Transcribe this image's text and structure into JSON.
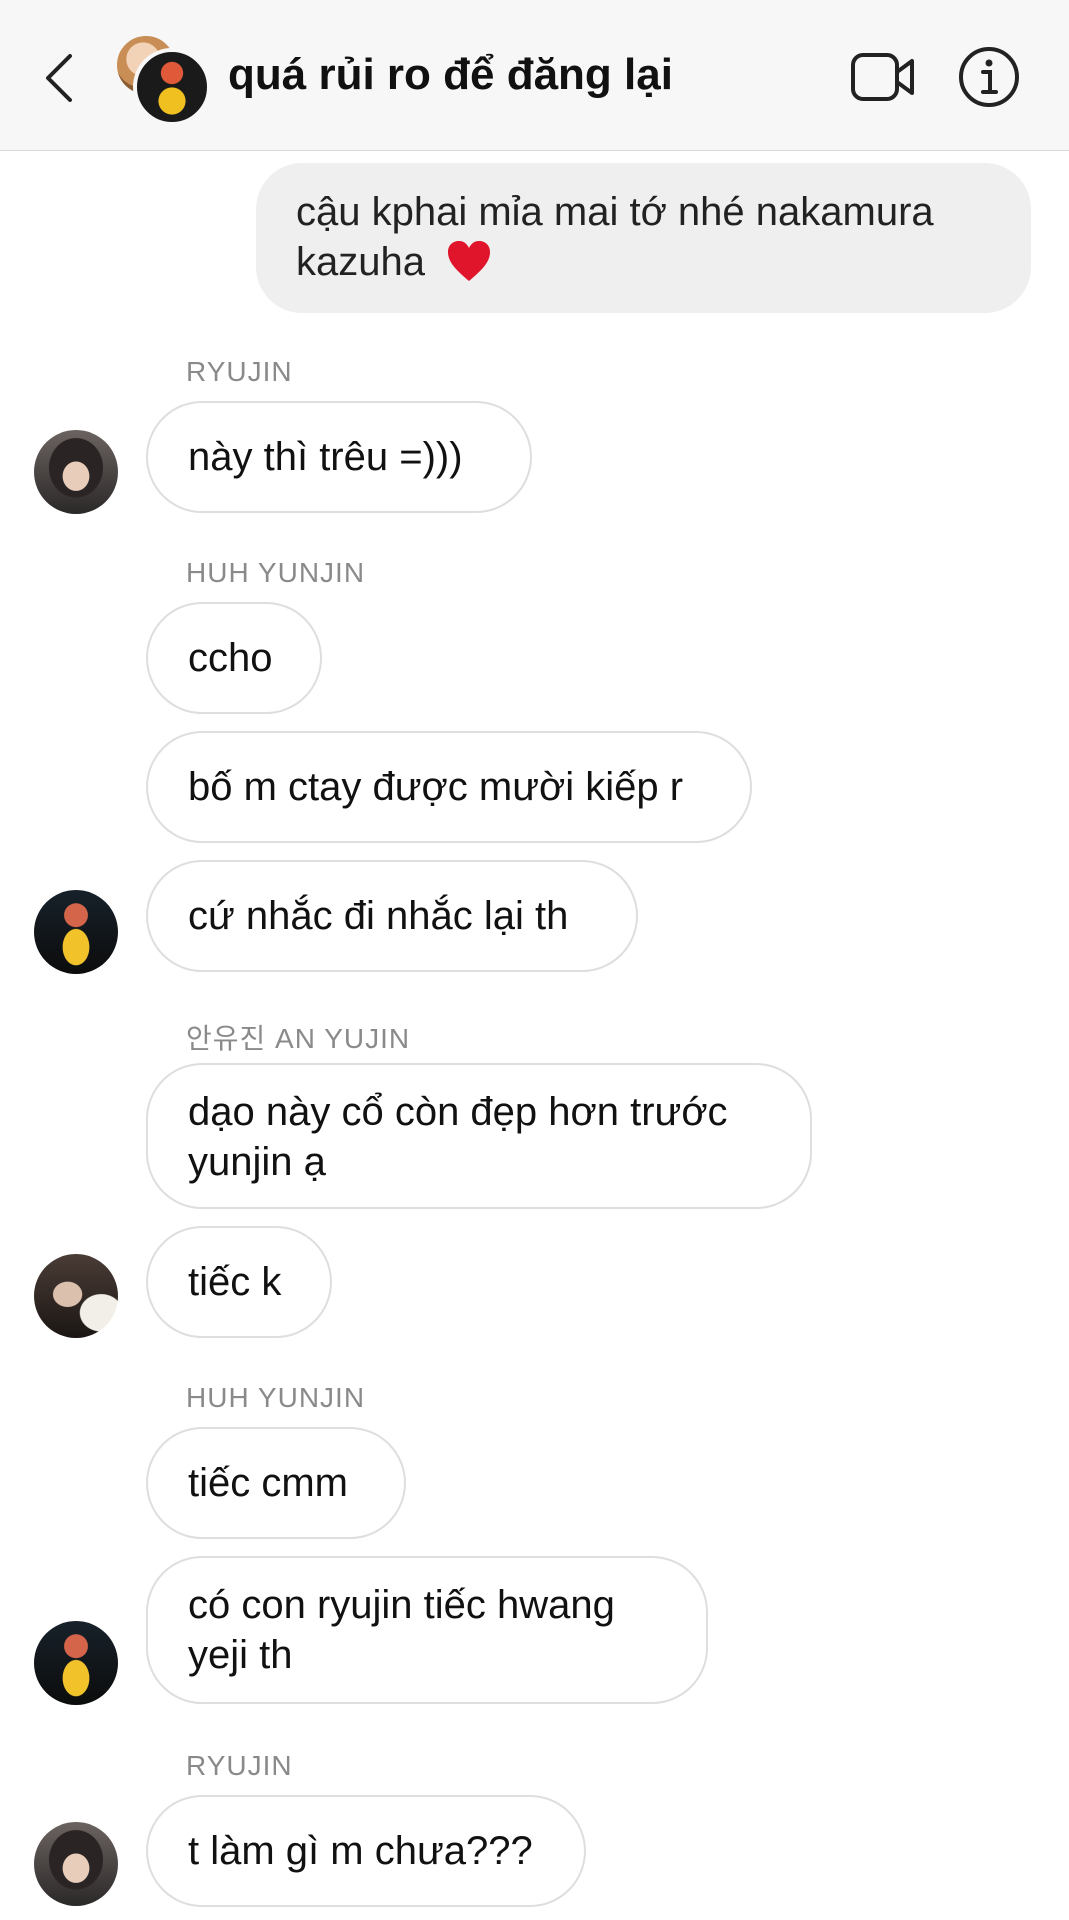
{
  "header": {
    "title": "quá rủi ro để đăng lại",
    "icons": {
      "back": "chevron-left-icon",
      "video": "video-camera-icon",
      "info": "info-icon"
    }
  },
  "messages": [
    {
      "sender": "",
      "text": "cậu kphai mỉa mai tớ nhé nakamura kazuha",
      "outgoing": true,
      "emoji": "heart"
    },
    {
      "sender": "RYUJIN",
      "text": "này thì trêu =)))"
    },
    {
      "sender": "HUH YUNJIN",
      "text": "ccho"
    },
    {
      "sender": "",
      "text": "bố m ctay được mười kiếp r"
    },
    {
      "sender": "",
      "text": "cứ nhắc đi nhắc lại th"
    },
    {
      "sender": "안유진 AN YUJIN",
      "text": "dạo này cổ còn đẹp hơn trước yunjin ạ"
    },
    {
      "sender": "",
      "text": "tiếc k"
    },
    {
      "sender": "HUH YUNJIN",
      "text": "tiếc cmm"
    },
    {
      "sender": "",
      "text": "có con ryujin tiếc hwang yeji th"
    },
    {
      "sender": "RYUJIN",
      "text": "t làm gì m chưa???"
    }
  ],
  "colors": {
    "header_bg": "#f7f7f7",
    "outgoing_bubble": "#efefef",
    "incoming_border": "#dedede",
    "heart": "#e0142a",
    "sender_label": "#8a8a8a"
  }
}
